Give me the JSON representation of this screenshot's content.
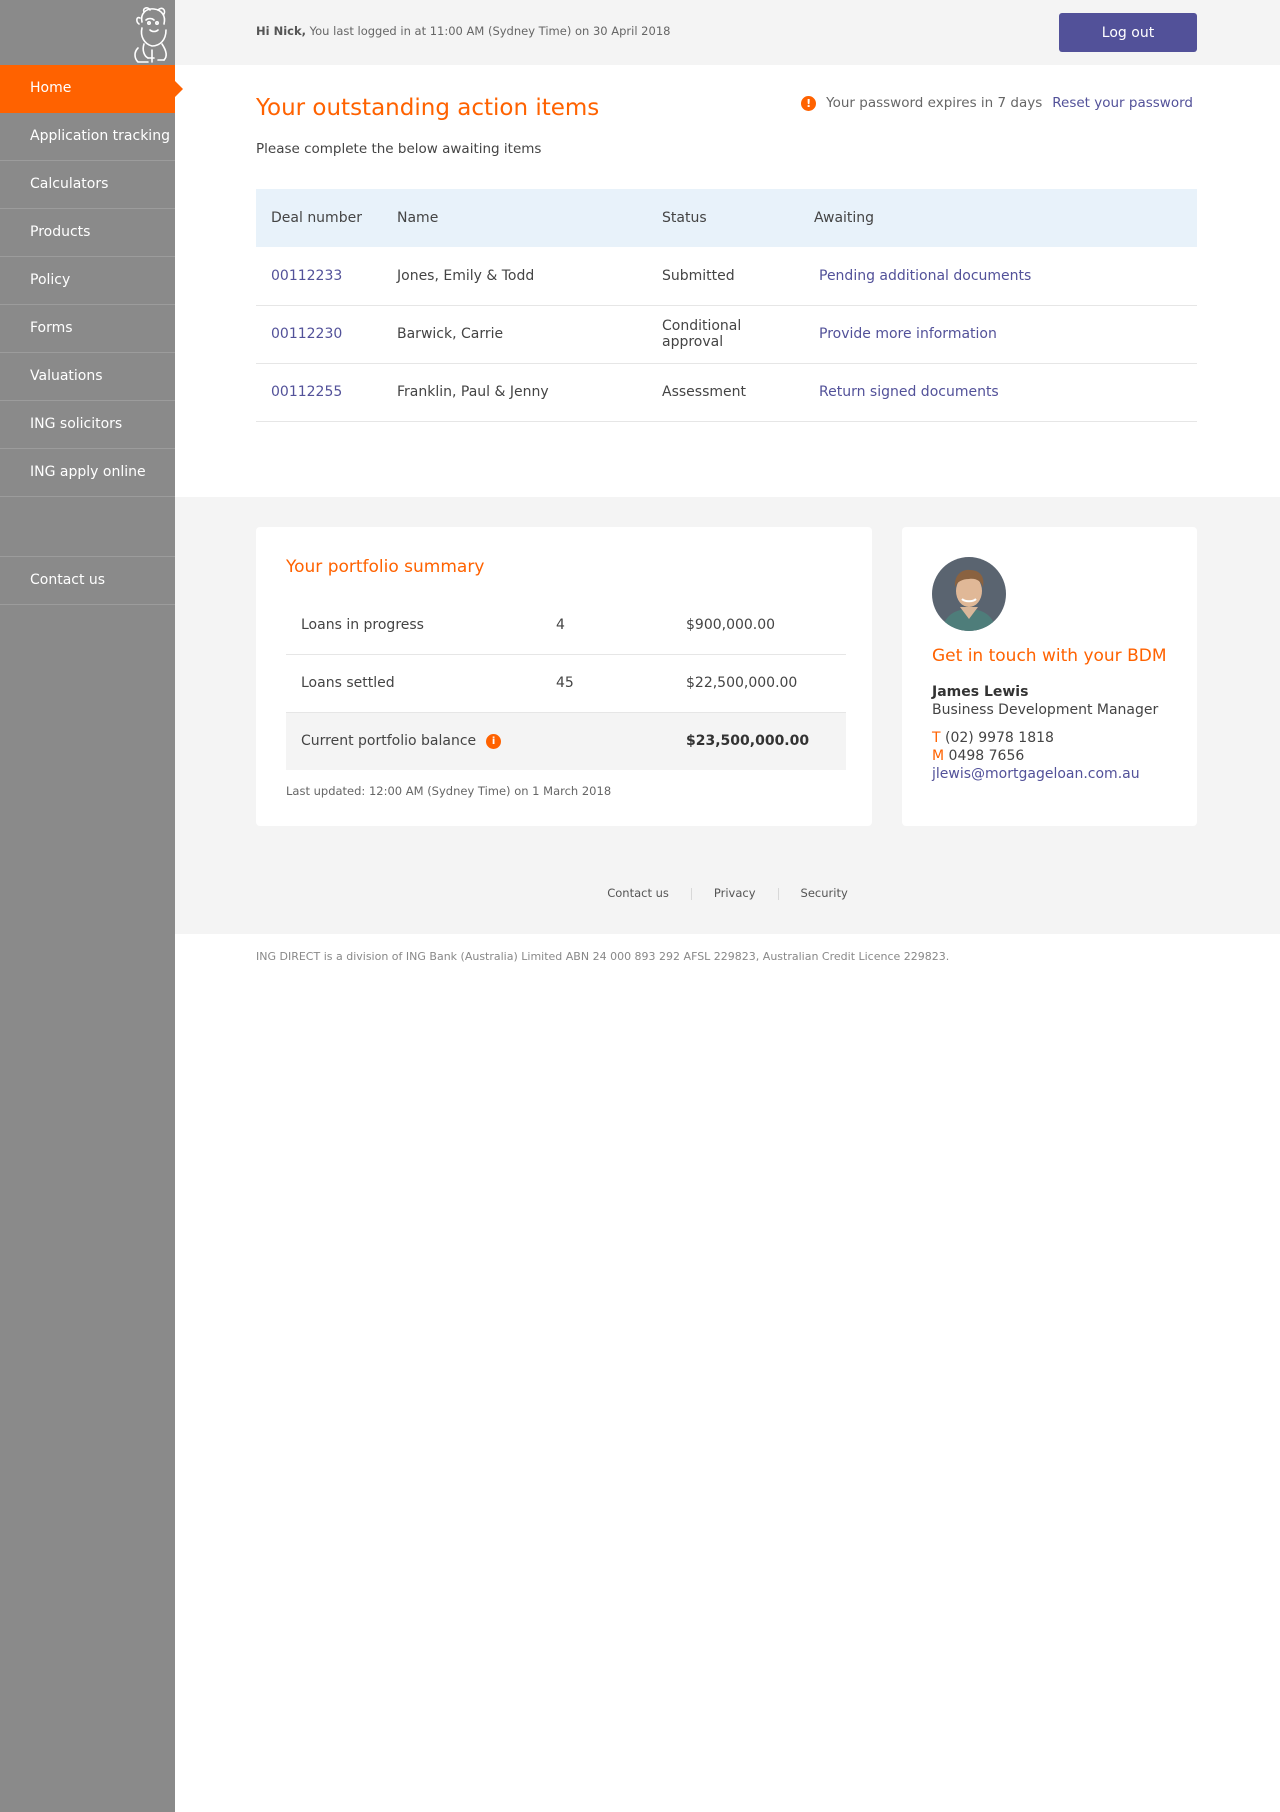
{
  "sidebar": {
    "items": [
      {
        "label": "Home",
        "active": true
      },
      {
        "label": "Application tracking"
      },
      {
        "label": "Calculators"
      },
      {
        "label": "Products"
      },
      {
        "label": "Policy"
      },
      {
        "label": "Forms"
      },
      {
        "label": "Valuations"
      },
      {
        "label": "ING solicitors"
      },
      {
        "label": "ING apply online"
      }
    ],
    "contact": "Contact us",
    "logo_icon": "lion-icon"
  },
  "header": {
    "greeting_name": "Hi Nick,",
    "greeting_text": "You last logged in at 11:00 AM (Sydney Time) on 30 April 2018",
    "logout_label": "Log out"
  },
  "actions": {
    "title": "Your outstanding action items",
    "subtitle": "Please complete the below awaiting items",
    "password_notice": "Your password expires in 7 days",
    "reset_link": "Reset your password",
    "columns": [
      "Deal number",
      "Name",
      "Status",
      "Awaiting"
    ],
    "rows": [
      {
        "deal": "00112233",
        "name": "Jones, Emily & Todd",
        "status": "Submitted",
        "awaiting": "Pending additional documents"
      },
      {
        "deal": "00112230",
        "name": "Barwick, Carrie",
        "status": "Conditional approval",
        "awaiting": "Provide more information"
      },
      {
        "deal": "00112255",
        "name": "Franklin, Paul & Jenny",
        "status": "Assessment",
        "awaiting": "Return signed documents"
      }
    ]
  },
  "portfolio": {
    "title": "Your portfolio summary",
    "rows": [
      {
        "label": "Loans in progress",
        "count": "4",
        "amount": "$900,000.00"
      },
      {
        "label": "Loans settled",
        "count": "45",
        "amount": "$22,500,000.00"
      },
      {
        "label": "Current portfolio balance",
        "count": "",
        "amount": "$23,500,000.00"
      }
    ],
    "last_updated": "Last updated: 12:00 AM (Sydney Time) on 1 March 2018"
  },
  "bdm": {
    "title": "Get in touch with your BDM",
    "name": "James Lewis",
    "role": "Business Development Manager",
    "phone_label": "T",
    "phone": "(02) 9978 1818",
    "mobile_label": "M",
    "mobile": "0498 7656",
    "email": "jlewis@mortgageloan.com.au"
  },
  "footer": {
    "links": [
      "Contact us",
      "Privacy",
      "Security"
    ],
    "disclaimer": "ING DIRECT is a division of ING Bank (Australia) Limited ABN 24 000 893 292 AFSL 229823, Australian Credit Licence 229823."
  },
  "colors": {
    "accent": "#ff6200",
    "link": "#525199",
    "sidebar": "#8a8a8a"
  }
}
